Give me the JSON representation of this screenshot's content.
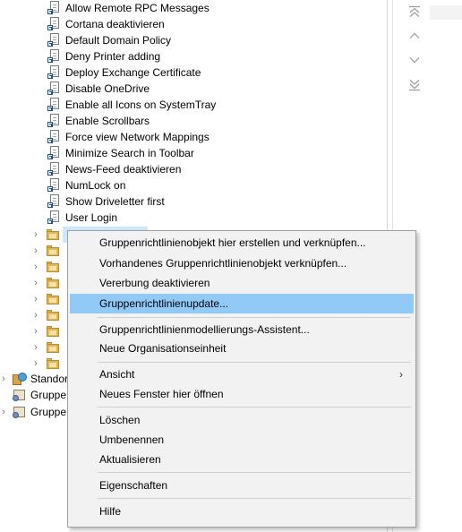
{
  "tree": {
    "gpo_items": [
      "Allow Remote RPC Messages",
      "Cortana deaktivieren",
      "Default Domain Policy",
      "Deny Printer adding",
      "Deploy Exchange Certificate",
      "Disable OneDrive",
      "Enable all Icons on SystemTray",
      "Enable Scrollbars",
      "Force view Network Mappings",
      "Minimize Search in Toolbar",
      "News-Feed deaktivieren",
      "NumLock on",
      "Show Driveletter first",
      "User Login"
    ],
    "bottom_nodes": [
      {
        "label": "Standor",
        "icon": "site-icon"
      },
      {
        "label": "Gruppe",
        "icon": "group-policy-icon"
      },
      {
        "label": "Gruppe",
        "icon": "group-policy-icon"
      }
    ]
  },
  "side_nav": {
    "icons": [
      "move-to-top-icon",
      "move-up-icon",
      "move-down-icon",
      "move-to-bottom-icon"
    ]
  },
  "context_menu": {
    "items": [
      {
        "label": "Gruppenrichtlinienobjekt hier erstellen und verknüpfen..."
      },
      {
        "label": "Vorhandenes Gruppenrichtlinienobjekt verknüpfen..."
      },
      {
        "label": "Vererbung deaktivieren"
      },
      {
        "label": "Gruppenrichtlinienupdate...",
        "highlighted": true
      },
      {
        "label": "Gruppenrichtlinienmodellierungs-Assistent..."
      },
      {
        "label": "Neue Organisationseinheit"
      },
      {
        "label": "Ansicht",
        "submenu": true
      },
      {
        "label": "Neues Fenster hier öffnen"
      },
      {
        "label": "Löschen"
      },
      {
        "label": "Umbenennen"
      },
      {
        "label": "Aktualisieren"
      },
      {
        "label": "Eigenschaften"
      },
      {
        "label": "Hilfe"
      }
    ],
    "submenu_glyph": "›"
  },
  "colors": {
    "highlight": "#91c9f7",
    "selection": "#cce8ff",
    "menu_bg": "#f2f2f2"
  }
}
